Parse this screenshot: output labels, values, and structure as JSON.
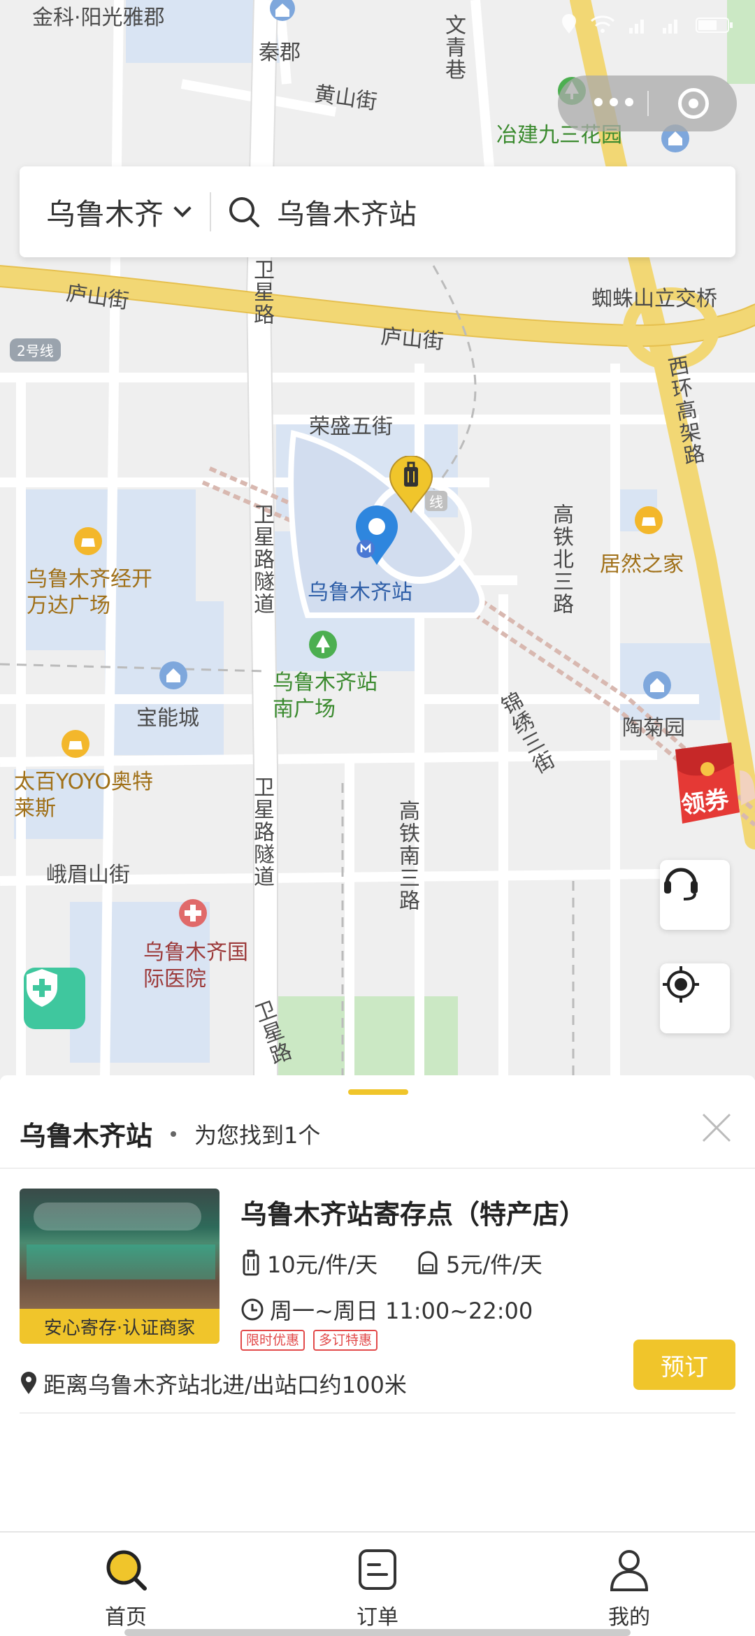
{
  "status_bar": {
    "icons": [
      "location-icon",
      "wifi-icon",
      "signal-icon",
      "signal-icon",
      "battery-icon"
    ]
  },
  "search": {
    "city": "乌鲁木齐",
    "query": "乌鲁木齐站"
  },
  "map": {
    "labels": {
      "jinke": "金科·阳光雅郡",
      "qinjun": "秦郡",
      "wenqing": "文青巷",
      "huangshan": "黄山街",
      "yejian": "冶建九三花园",
      "lushan1": "庐山街",
      "lushan2": "庐山街",
      "zhizhu": "蜘蛛山立交桥",
      "weixing": "卫星路",
      "line2": "2号线",
      "xihuan": "西环高架路",
      "rongsheng": "荣盛五街",
      "line_badge": "线",
      "gaotiebei": "高铁北三路",
      "juran": "居然之家",
      "wanda": "乌鲁木齐经开万达广场",
      "weixing_tunnel": "卫星路隧道",
      "station": "乌鲁木齐站",
      "station_south": "乌鲁木齐站南广场",
      "baoneng": "宝能城",
      "jinxiu": "锦绣三街",
      "taoju": "陶菊园",
      "yoyo": "太百YOYO奥特莱斯",
      "weixing_tunnel2": "卫星路隧道",
      "gaotienan": "高铁南三路",
      "emei": "峨眉山街",
      "hospital": "乌鲁木齐国际医院",
      "weixing3": "卫星路"
    },
    "coupon_label": "领券"
  },
  "panel": {
    "station_name": "乌鲁木齐站",
    "found_text": "为您找到1个",
    "store": {
      "title": "乌鲁木齐站寄存点（特产店）",
      "badge": "安心寄存·认证商家",
      "price_luggage": "10元/件/天",
      "price_bag": "5元/件/天",
      "hours": "周一~周日 11:00~22:00",
      "tags": [
        "限时优惠",
        "多订特惠"
      ],
      "distance": "距离乌鲁木齐站北进/出站口约100米",
      "book_label": "预订"
    }
  },
  "tabbar": {
    "home": "首页",
    "orders": "订单",
    "mine": "我的"
  },
  "colors": {
    "accent": "#f0c52b",
    "road_major": "#f2d774",
    "map_bg": "#efefef",
    "block_blue": "#d9e4f3",
    "park_green": "#cbe8c4",
    "pin_blue": "#2e86de",
    "tag_red": "#e24a4a"
  }
}
